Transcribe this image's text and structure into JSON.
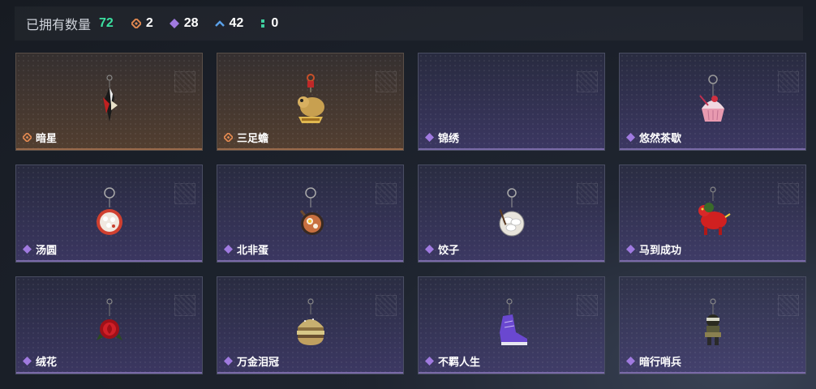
{
  "header": {
    "owned_label": "已拥有数量",
    "owned_count": "72",
    "rarities": [
      {
        "icon": "orange-diamond-icon",
        "color": "#e08850",
        "count": "2"
      },
      {
        "icon": "purple-diamond-icon",
        "color": "#a07ae0",
        "count": "28"
      },
      {
        "icon": "blue-chevron-icon",
        "color": "#5aa0e8",
        "count": "42"
      },
      {
        "icon": "green-dots-icon",
        "color": "#3fd0a0",
        "count": "0"
      }
    ]
  },
  "items": [
    {
      "name": "暗星",
      "rarity": "orange"
    },
    {
      "name": "三足蟾",
      "rarity": "orange"
    },
    {
      "name": "锦绣",
      "rarity": "purple"
    },
    {
      "name": "悠然茶歇",
      "rarity": "purple"
    },
    {
      "name": "汤圆",
      "rarity": "purple"
    },
    {
      "name": "北非蛋",
      "rarity": "purple"
    },
    {
      "name": "饺子",
      "rarity": "purple"
    },
    {
      "name": "马到成功",
      "rarity": "purple"
    },
    {
      "name": "绒花",
      "rarity": "purple"
    },
    {
      "name": "万金泪冠",
      "rarity": "purple"
    },
    {
      "name": "不羁人生",
      "rarity": "purple"
    },
    {
      "name": "暗行哨兵",
      "rarity": "purple"
    }
  ]
}
